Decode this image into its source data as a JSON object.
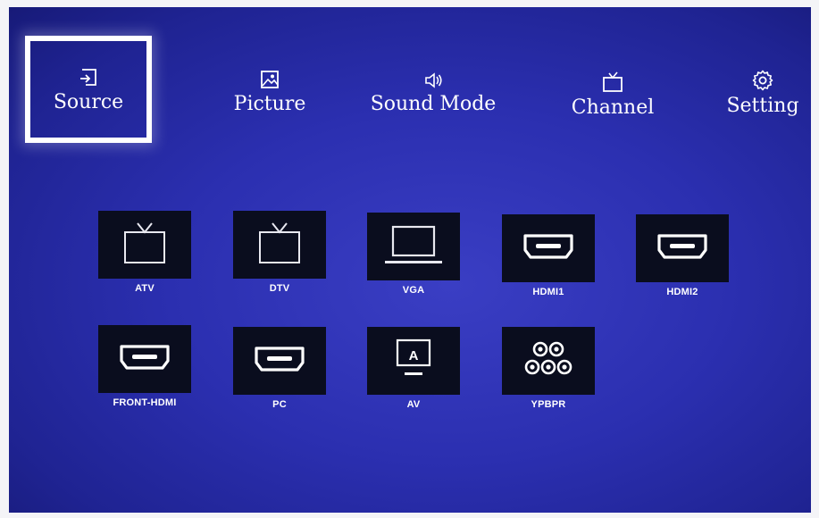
{
  "menu": {
    "items": [
      {
        "label": "Source",
        "icon": "source-input-icon",
        "selected": true
      },
      {
        "label": "Picture",
        "icon": "picture-icon"
      },
      {
        "label": "Sound Mode",
        "icon": "speaker-icon"
      },
      {
        "label": "Channel",
        "icon": "tv-antenna-icon"
      },
      {
        "label": "Setting",
        "icon": "gear-icon"
      }
    ]
  },
  "sources": [
    {
      "label": "ATV",
      "icon": "tv-antenna-icon"
    },
    {
      "label": "DTV",
      "icon": "tv-antenna-icon"
    },
    {
      "label": "VGA",
      "icon": "laptop-icon"
    },
    {
      "label": "HDMI1",
      "icon": "hdmi-port-icon"
    },
    {
      "label": "HDMI2",
      "icon": "hdmi-port-icon"
    },
    {
      "label": "FRONT-HDMI",
      "icon": "hdmi-port-icon"
    },
    {
      "label": "PC",
      "icon": "hdmi-port-icon"
    },
    {
      "label": "AV",
      "icon": "av-monitor-icon"
    },
    {
      "label": "YPBPR",
      "icon": "component-ports-icon"
    }
  ],
  "colors": {
    "background": "#2b2fb0",
    "tile": "#0a0d1e",
    "selection_border": "#ffffff",
    "text": "#ffffff"
  }
}
